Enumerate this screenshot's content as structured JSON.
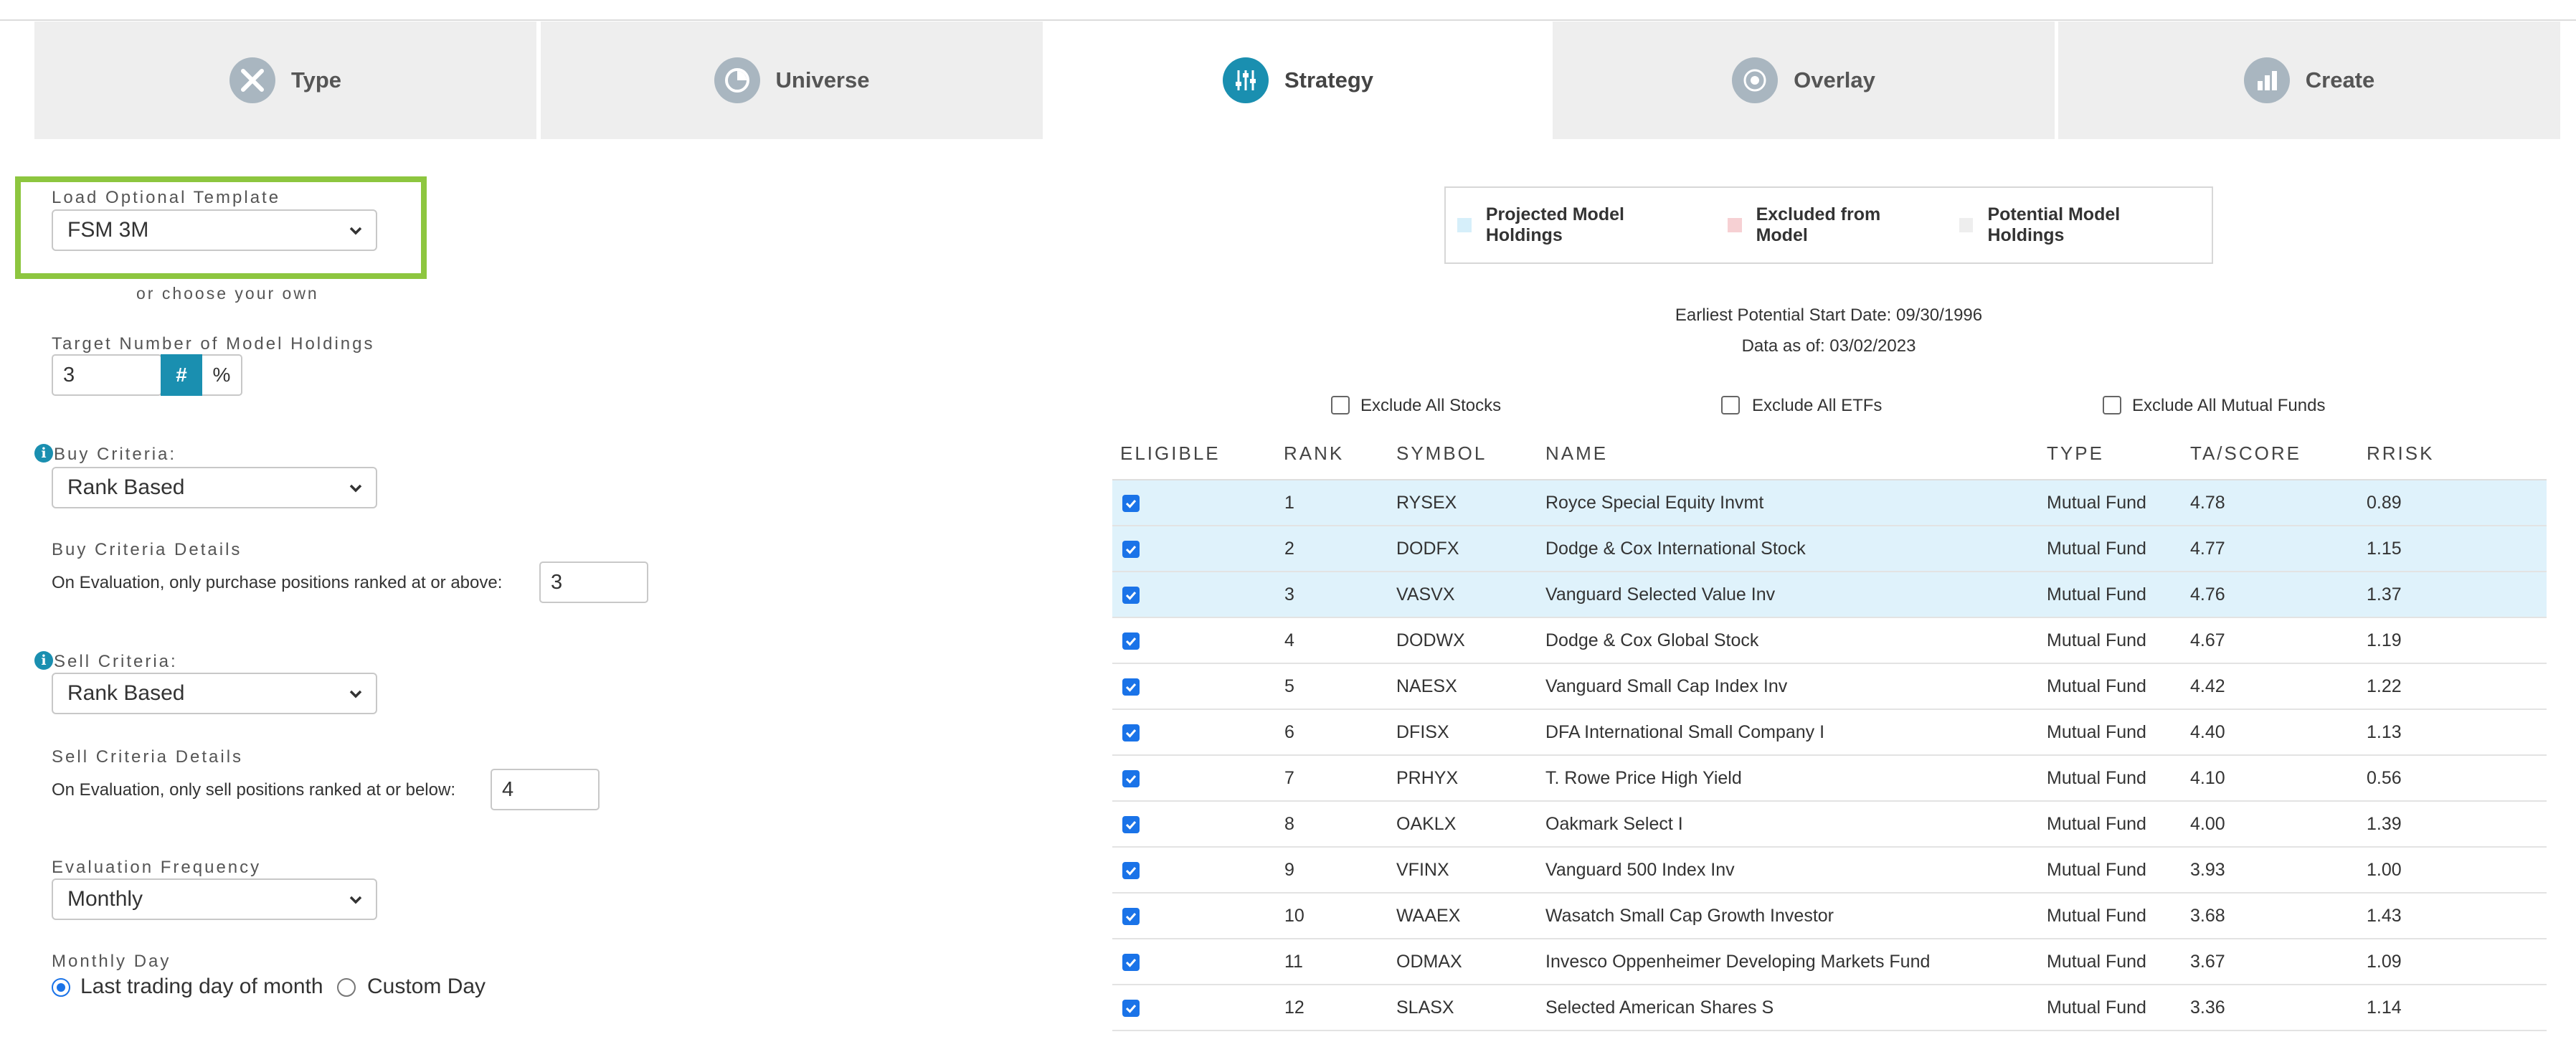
{
  "tabs": [
    {
      "label": "Type",
      "icon": "tools-icon",
      "active": false
    },
    {
      "label": "Universe",
      "icon": "pie-chart-icon",
      "active": false
    },
    {
      "label": "Strategy",
      "icon": "sliders-icon",
      "active": true
    },
    {
      "label": "Overlay",
      "icon": "target-icon",
      "active": false
    },
    {
      "label": "Create",
      "icon": "bar-chart-icon",
      "active": false
    }
  ],
  "form": {
    "template_label": "Load Optional Template",
    "template_value": "FSM 3M",
    "choose_own": "or choose your own",
    "target_label": "Target Number of Model Holdings",
    "target_value": "3",
    "unit_hash": "#",
    "unit_pct": "%",
    "buy_label": "Buy Criteria:",
    "buy_value": "Rank Based",
    "buy_details_label": "Buy Criteria Details",
    "buy_details_text": "On Evaluation, only purchase positions ranked at or above:",
    "buy_details_value": "3",
    "sell_label": "Sell Criteria:",
    "sell_value": "Rank Based",
    "sell_details_label": "Sell Criteria Details",
    "sell_details_text": "On Evaluation, only sell positions ranked at or below:",
    "sell_details_value": "4",
    "freq_label": "Evaluation Frequency",
    "freq_value": "Monthly",
    "day_label": "Monthly Day",
    "day_option1": "Last trading day of month",
    "day_option2": "Custom Day",
    "info_glyph": "i"
  },
  "legend": {
    "projected": "Projected Model Holdings",
    "excluded": "Excluded from Model",
    "potential": "Potential Model Holdings",
    "colors": {
      "projected": "#d6effa",
      "excluded": "#f6d0d3",
      "potential": "#eeeeee"
    }
  },
  "info": {
    "start_date": "Earliest Potential Start Date: 09/30/1996",
    "data_as_of": "Data as of: 03/02/2023"
  },
  "excludes": {
    "stocks": "Exclude All Stocks",
    "etfs": "Exclude All ETFs",
    "funds": "Exclude All Mutual Funds"
  },
  "table": {
    "headers": [
      "ELIGIBLE",
      "RANK",
      "SYMBOL",
      "NAME",
      "TYPE",
      "TA/SCORE",
      "RRISK"
    ],
    "rows": [
      {
        "rank": "1",
        "symbol": "RYSEX",
        "name": "Royce Special Equity Invmt",
        "type": "Mutual Fund",
        "score": "4.78",
        "risk": "0.89",
        "projected": true
      },
      {
        "rank": "2",
        "symbol": "DODFX",
        "name": "Dodge & Cox International Stock",
        "type": "Mutual Fund",
        "score": "4.77",
        "risk": "1.15",
        "projected": true
      },
      {
        "rank": "3",
        "symbol": "VASVX",
        "name": "Vanguard Selected Value Inv",
        "type": "Mutual Fund",
        "score": "4.76",
        "risk": "1.37",
        "projected": true
      },
      {
        "rank": "4",
        "symbol": "DODWX",
        "name": "Dodge & Cox Global Stock",
        "type": "Mutual Fund",
        "score": "4.67",
        "risk": "1.19",
        "projected": false
      },
      {
        "rank": "5",
        "symbol": "NAESX",
        "name": "Vanguard Small Cap Index Inv",
        "type": "Mutual Fund",
        "score": "4.42",
        "risk": "1.22",
        "projected": false
      },
      {
        "rank": "6",
        "symbol": "DFISX",
        "name": "DFA International Small Company I",
        "type": "Mutual Fund",
        "score": "4.40",
        "risk": "1.13",
        "projected": false
      },
      {
        "rank": "7",
        "symbol": "PRHYX",
        "name": "T. Rowe Price High Yield",
        "type": "Mutual Fund",
        "score": "4.10",
        "risk": "0.56",
        "projected": false
      },
      {
        "rank": "8",
        "symbol": "OAKLX",
        "name": "Oakmark Select I",
        "type": "Mutual Fund",
        "score": "4.00",
        "risk": "1.39",
        "projected": false
      },
      {
        "rank": "9",
        "symbol": "VFINX",
        "name": "Vanguard 500 Index Inv",
        "type": "Mutual Fund",
        "score": "3.93",
        "risk": "1.00",
        "projected": false
      },
      {
        "rank": "10",
        "symbol": "WAAEX",
        "name": "Wasatch Small Cap Growth Investor",
        "type": "Mutual Fund",
        "score": "3.68",
        "risk": "1.43",
        "projected": false
      },
      {
        "rank": "11",
        "symbol": "ODMAX",
        "name": "Invesco Oppenheimer Developing Markets Fund",
        "type": "Mutual Fund",
        "score": "3.67",
        "risk": "1.09",
        "projected": false
      },
      {
        "rank": "12",
        "symbol": "SLASX",
        "name": "Selected American Shares S",
        "type": "Mutual Fund",
        "score": "3.36",
        "risk": "1.14",
        "projected": false
      }
    ]
  }
}
